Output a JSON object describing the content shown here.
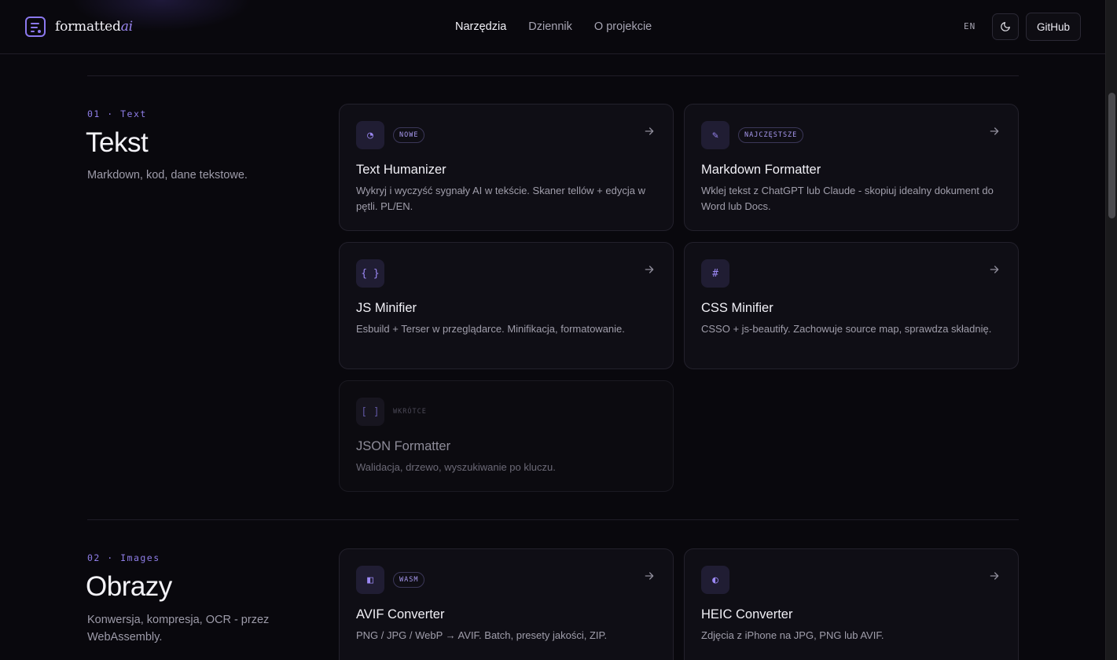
{
  "header": {
    "logo_main": "formatted",
    "logo_accent": "ai",
    "nav": [
      {
        "label": "Narzędzia",
        "active": true
      },
      {
        "label": "Dziennik",
        "active": false
      },
      {
        "label": "O projekcie",
        "active": false
      }
    ],
    "lang": "EN",
    "theme_icon": "moon-icon",
    "github_label": "GitHub"
  },
  "sections": [
    {
      "label": "01 · Text",
      "title": "Tekst",
      "description": "Markdown, kod, dane tekstowe.",
      "cards": [
        {
          "icon": "◔",
          "icon_name": "pie-icon",
          "badge": "NOWE",
          "title": "Text Humanizer",
          "description": "Wykryj i wyczyść sygnały AI w tekście. Skaner tellów + edycja w pętli. PL/EN."
        },
        {
          "icon": "✎",
          "icon_name": "pencil-icon",
          "badge": "NAJCZĘSTSZE",
          "title": "Markdown Formatter",
          "description": "Wklej tekst z ChatGPT lub Claude - skopiuj idealny dokument do Word lub Docs."
        },
        {
          "icon": "{ }",
          "icon_name": "braces-icon",
          "badge": "",
          "title": "JS Minifier",
          "description": "Esbuild + Terser w przeglądarce. Minifikacja, formatowanie."
        },
        {
          "icon": "#",
          "icon_name": "hash-icon",
          "badge": "",
          "title": "CSS Minifier",
          "description": "CSSO + js-beautify. Zachowuje source map, sprawdza składnię."
        },
        {
          "icon": "[ ]",
          "icon_name": "brackets-icon",
          "badge": "WKRÓTCE",
          "title": "JSON Formatter",
          "description": "Walidacja, drzewo, wyszukiwanie po kluczu."
        }
      ]
    },
    {
      "label": "02 · Images",
      "title": "Obrazy",
      "description": "Konwersja, kompresja, OCR - przez WebAssembly.",
      "cards": [
        {
          "icon": "◧",
          "icon_name": "half-square-icon",
          "badge": "WASM",
          "title": "AVIF Converter",
          "description": "PNG / JPG / WebP → AVIF. Batch, presety jakości, ZIP."
        },
        {
          "icon": "◐",
          "icon_name": "half-circle-icon",
          "badge": "",
          "title": "HEIC Converter",
          "description": "Zdjęcia z iPhone na JPG, PNG lub AVIF."
        }
      ]
    }
  ]
}
